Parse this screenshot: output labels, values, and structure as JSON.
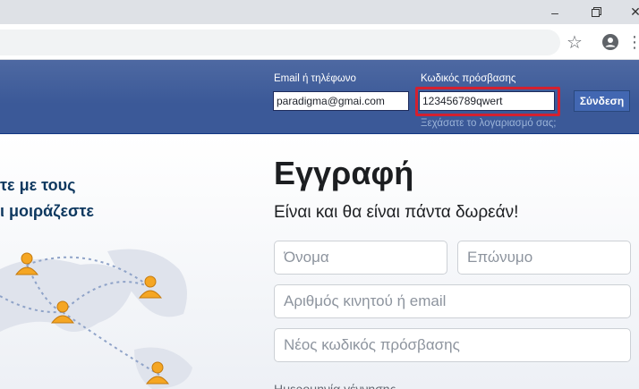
{
  "browser": {
    "window_controls": {
      "minimize": "–",
      "restore": "❐",
      "close": "✕"
    },
    "toolbar_icons": {
      "bookmark": "☆",
      "menu": "⋮"
    }
  },
  "login": {
    "email_label": "Email ή τηλέφωνο",
    "email_value": "paradigma@gmai.com",
    "password_label": "Κωδικός πρόσβασης",
    "password_value": "123456789qwert",
    "login_button": "Σύνδεση",
    "forgot_link": "Ξεχάσατε το λογαριασμό σας;"
  },
  "intro": {
    "line1": "τε με τους",
    "line2": "ι μοιράζεστε"
  },
  "signup": {
    "title": "Εγγραφή",
    "subtitle": "Είναι και θα είναι πάντα δωρεάν!",
    "first_name_placeholder": "Όνομα",
    "last_name_placeholder": "Επώνυμο",
    "contact_placeholder": "Αριθμός κινητού ή email",
    "password_placeholder": "Νέος κωδικός πρόσβασης",
    "birthday_label": "Ημερομηνία γέννησης"
  },
  "colors": {
    "header_blue": "#3b5998",
    "highlight_red": "#d4202f",
    "button_blue": "#4267b2"
  }
}
